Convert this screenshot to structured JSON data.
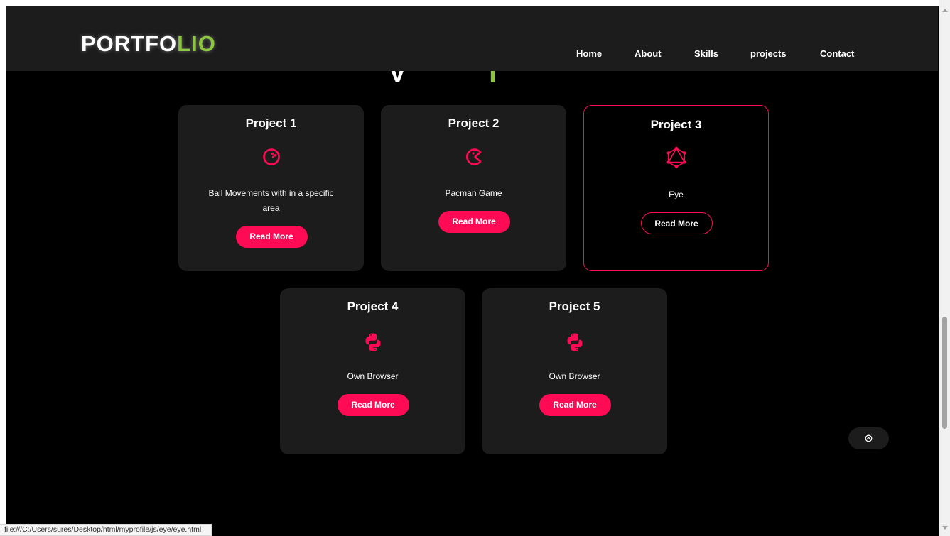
{
  "logo": {
    "main": "PORTFO",
    "accent": "LIO"
  },
  "nav": {
    "items": [
      {
        "label": "Home"
      },
      {
        "label": "About"
      },
      {
        "label": "Skills"
      },
      {
        "label": "projects"
      },
      {
        "label": "Contact"
      }
    ]
  },
  "projects": [
    {
      "title": "Project 1",
      "icon": "bowling-ball-icon",
      "description": "Ball Movements with in a specific area",
      "button": "Read More"
    },
    {
      "title": "Project 2",
      "icon": "pacman-icon",
      "description": "Pacman Game",
      "button": "Read More"
    },
    {
      "title": "Project 3",
      "icon": "graphql-icon",
      "description": "Eye",
      "button": "Read More"
    },
    {
      "title": "Project 4",
      "icon": "python-icon",
      "description": "Own Browser",
      "button": "Read More"
    },
    {
      "title": "Project 5",
      "icon": "python-icon",
      "description": "Own Browser",
      "button": "Read More"
    }
  ],
  "status_bar": {
    "url": "file:///C:/Users/sures/Desktop/html/myprofile/js/eye/eye.html"
  },
  "colors": {
    "accent": "#ff0a54",
    "logo_accent": "#8cc63f",
    "card_bg": "#1c1c1c",
    "page_bg": "#000000"
  }
}
